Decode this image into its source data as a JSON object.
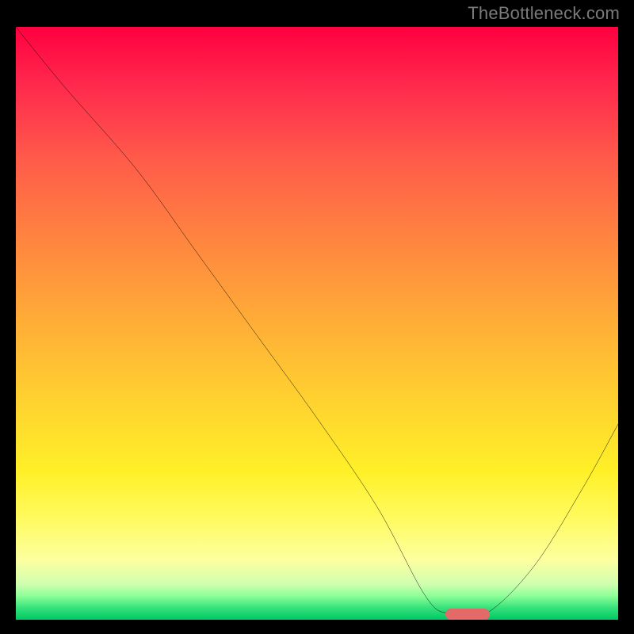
{
  "watermark": "TheBottleneck.com",
  "chart_data": {
    "type": "line",
    "title": "",
    "xlabel": "",
    "ylabel": "",
    "xlim": [
      0,
      100
    ],
    "ylim": [
      0,
      100
    ],
    "grid": false,
    "legend": false,
    "series": [
      {
        "name": "curve",
        "color": "#000000",
        "x": [
          0,
          8,
          20,
          30,
          40,
          50,
          60,
          68,
          72,
          78,
          86,
          94,
          100
        ],
        "y": [
          100,
          90,
          76,
          62,
          48,
          34,
          19,
          4,
          1,
          1,
          9,
          22,
          33
        ]
      }
    ],
    "marker": {
      "x": 75,
      "y": 1,
      "color": "#e46a6a"
    },
    "gradient_stops": [
      {
        "pos": 0.0,
        "color": "#ff0040"
      },
      {
        "pos": 0.1,
        "color": "#ff2a4d"
      },
      {
        "pos": 0.22,
        "color": "#ff5a4a"
      },
      {
        "pos": 0.35,
        "color": "#ff8240"
      },
      {
        "pos": 0.48,
        "color": "#ffa838"
      },
      {
        "pos": 0.62,
        "color": "#ffcf30"
      },
      {
        "pos": 0.75,
        "color": "#fff028"
      },
      {
        "pos": 0.83,
        "color": "#fffb60"
      },
      {
        "pos": 0.9,
        "color": "#fcffa0"
      },
      {
        "pos": 0.94,
        "color": "#d0ffb0"
      },
      {
        "pos": 0.96,
        "color": "#8cff98"
      },
      {
        "pos": 0.98,
        "color": "#35e27a"
      },
      {
        "pos": 1.0,
        "color": "#00c864"
      }
    ]
  }
}
